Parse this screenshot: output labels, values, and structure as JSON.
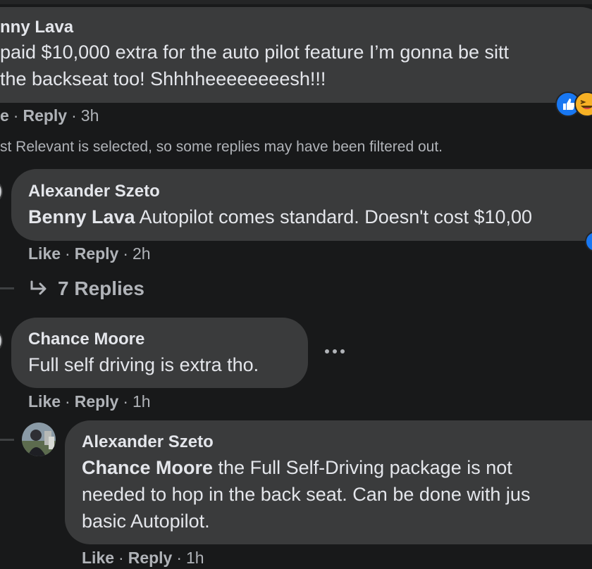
{
  "comments": [
    {
      "author": "nny Lava",
      "text_lines": [
        " paid $10,000 extra for the auto pilot feature I’m gonna be sitt",
        "the backseat too! Shhhheeeeeeeesh!!!"
      ],
      "actions": {
        "like": "e",
        "reply": "Reply",
        "time": "3h"
      },
      "reactions": [
        "like-reaction-icon",
        "haha-reaction-icon"
      ]
    },
    {
      "author": "Alexander Szeto",
      "mention": "Benny Lava",
      "text": " Autopilot comes standard. Doesn't cost $10,00",
      "actions": {
        "like": "Like",
        "reply": "Reply",
        "time": "2h"
      },
      "replies_label": "7 Replies"
    },
    {
      "author": "Chance Moore",
      "text": "Full self driving is extra tho.",
      "actions": {
        "like": "Like",
        "reply": "Reply",
        "time": "1h"
      }
    },
    {
      "author": "Alexander Szeto",
      "mention": "Chance Moore",
      "text_lines": [
        " the Full Self-Driving package is not",
        "needed to hop in the back seat. Can be done with jus",
        "basic Autopilot."
      ],
      "actions": {
        "like": "Like",
        "reply": "Reply",
        "time": "1h"
      }
    }
  ],
  "filter_notice": "st Relevant is selected, so some replies may have been filtered out.",
  "separator": "·",
  "colors": {
    "background": "#18191a",
    "bubble": "#3a3b3c",
    "primary_text": "#e4e6eb",
    "secondary_text": "#b0b3b8",
    "like_blue": "#1877f2",
    "haha_yellow": "#f7b125"
  },
  "icons": {
    "reply_arrow": "reply-arrow-icon",
    "more": "more-options-icon"
  }
}
